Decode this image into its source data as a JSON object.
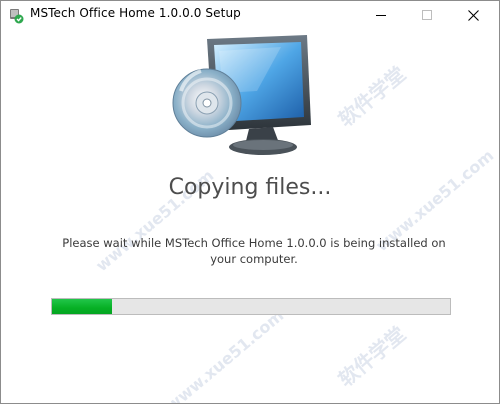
{
  "window": {
    "title": "MSTech Office Home 1.0.0.0 Setup",
    "icon": "installer-icon"
  },
  "controls": {
    "minimize_icon": "minimize-icon",
    "maximize_icon": "maximize-icon",
    "close_icon": "close-icon"
  },
  "main": {
    "hero_icon": "computer-with-disc-icon",
    "heading": "Copying files...",
    "message": "Please wait while MSTech Office Home 1.0.0.0 is being installed on your computer."
  },
  "progress": {
    "percent": 15,
    "color": "#06b025"
  },
  "watermark": {
    "text_cn": "软件学堂",
    "text_url": "www.xue51.com"
  }
}
